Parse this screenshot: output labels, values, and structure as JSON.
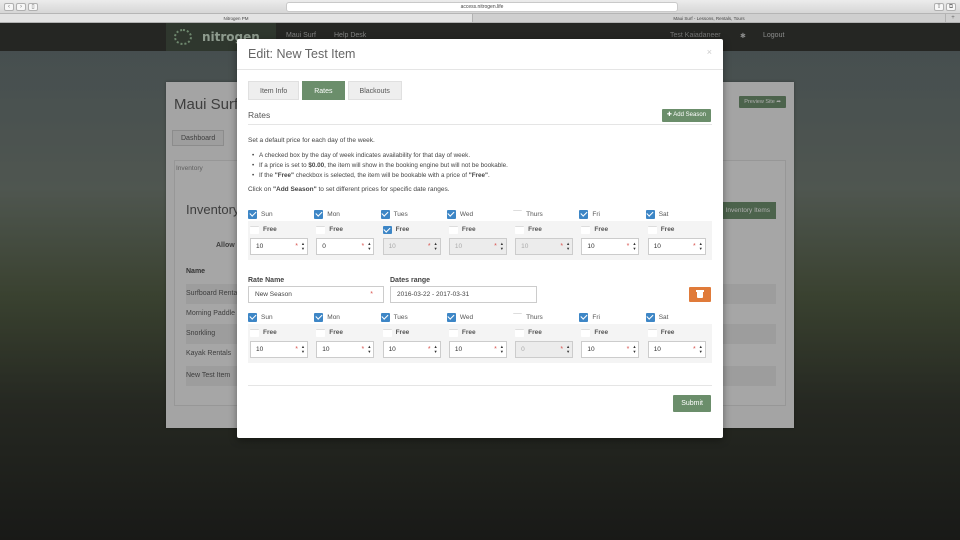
{
  "browser": {
    "url": "access.nitrogen.life",
    "tab_left": "Nitrogen PM",
    "tab_right": "Maui Surf - Lessons, Rentals, Tours"
  },
  "appnav": {
    "logo": "nitrogen",
    "links": [
      "Maui Surf",
      "Help Desk"
    ],
    "user": "Test Kaiadaneer",
    "logout": "Logout"
  },
  "bg_page": {
    "title": "Maui Surf",
    "preview_btn": "Preview Site",
    "dashboard_tab": "Dashboard",
    "inventory_tab": "Inventory",
    "inventory_heading": "Inventory",
    "inventory_btn": "Inventory Items",
    "allow_label": "Allow",
    "name_header": "Name",
    "rows": [
      "Surfboard Rentals",
      "Morning Paddle",
      "Snorkling",
      "Kayak Rentals",
      "New Test Item"
    ]
  },
  "modal": {
    "title": "Edit: New Test Item",
    "tabs": [
      "Item Info",
      "Rates",
      "Blackouts"
    ],
    "rates_title": "Rates",
    "add_season": "Add Season",
    "intro": "Set a default price for each day of the week.",
    "bullet1": "A checked box by the day of week indicates availability for that day of week.",
    "bullet2_pre": "If a price is set to ",
    "bullet2_bold": "$0.00",
    "bullet2_post": ", the item will show in the booking engine but will not be bookable.",
    "bullet3_pre": "If the ",
    "bullet3_bold": "\"Free\"",
    "bullet3_mid": " checkbox is selected, the item will be bookable with a price of ",
    "bullet3_bold2": "\"Free\"",
    "bullet3_end": ".",
    "click_pre": "Click on ",
    "click_bold": "\"Add Season\"",
    "click_post": " to set different prices for specific date ranges.",
    "free_label": "Free",
    "default_rates": [
      {
        "day": "Sun",
        "checked": true,
        "free": false,
        "price": "10",
        "disabled": false
      },
      {
        "day": "Mon",
        "checked": true,
        "free": false,
        "price": "0",
        "disabled": false
      },
      {
        "day": "Tues",
        "checked": true,
        "free": true,
        "price": "10",
        "disabled": true
      },
      {
        "day": "Wed",
        "checked": true,
        "free": false,
        "price": "10",
        "disabled": true
      },
      {
        "day": "Thurs",
        "checked": false,
        "free": false,
        "price": "10",
        "disabled": true
      },
      {
        "day": "Fri",
        "checked": true,
        "free": false,
        "price": "10",
        "disabled": false
      },
      {
        "day": "Sat",
        "checked": true,
        "free": false,
        "price": "10",
        "disabled": false
      }
    ],
    "rate_name_label": "Rate Name",
    "rate_name_value": "New Season",
    "dates_label": "Dates range",
    "dates_value": "2016-03-22 - 2017-03-31",
    "season_rates": [
      {
        "day": "Sun",
        "checked": true,
        "free": false,
        "price": "10",
        "disabled": false
      },
      {
        "day": "Mon",
        "checked": true,
        "free": false,
        "price": "10",
        "disabled": false
      },
      {
        "day": "Tues",
        "checked": true,
        "free": false,
        "price": "10",
        "disabled": false
      },
      {
        "day": "Wed",
        "checked": true,
        "free": false,
        "price": "10",
        "disabled": false
      },
      {
        "day": "Thurs",
        "checked": false,
        "free": false,
        "price": "0",
        "disabled": true
      },
      {
        "day": "Fri",
        "checked": true,
        "free": false,
        "price": "10",
        "disabled": false
      },
      {
        "day": "Sat",
        "checked": true,
        "free": false,
        "price": "10",
        "disabled": false
      }
    ],
    "submit": "Submit"
  }
}
